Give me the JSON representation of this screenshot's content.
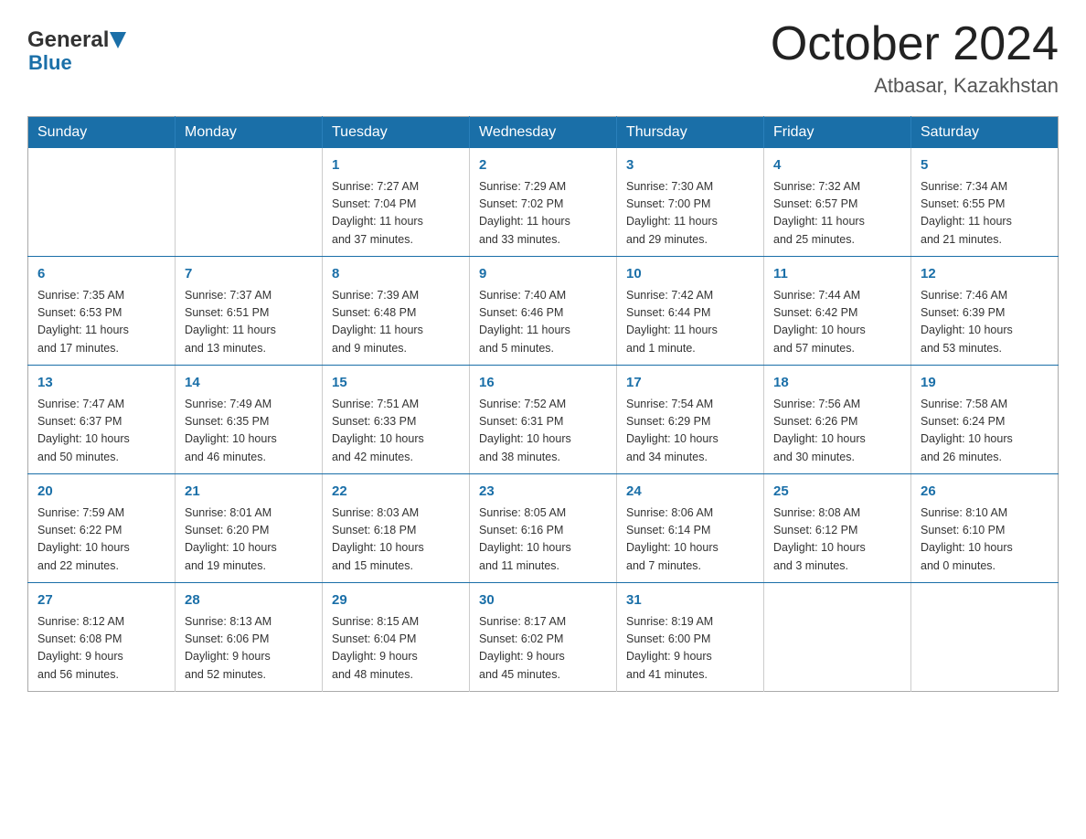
{
  "header": {
    "logo_general": "General",
    "logo_blue": "Blue",
    "month_title": "October 2024",
    "location": "Atbasar, Kazakhstan"
  },
  "days_of_week": [
    "Sunday",
    "Monday",
    "Tuesday",
    "Wednesday",
    "Thursday",
    "Friday",
    "Saturday"
  ],
  "weeks": [
    [
      {
        "day": "",
        "info": ""
      },
      {
        "day": "",
        "info": ""
      },
      {
        "day": "1",
        "info": "Sunrise: 7:27 AM\nSunset: 7:04 PM\nDaylight: 11 hours\nand 37 minutes."
      },
      {
        "day": "2",
        "info": "Sunrise: 7:29 AM\nSunset: 7:02 PM\nDaylight: 11 hours\nand 33 minutes."
      },
      {
        "day": "3",
        "info": "Sunrise: 7:30 AM\nSunset: 7:00 PM\nDaylight: 11 hours\nand 29 minutes."
      },
      {
        "day": "4",
        "info": "Sunrise: 7:32 AM\nSunset: 6:57 PM\nDaylight: 11 hours\nand 25 minutes."
      },
      {
        "day": "5",
        "info": "Sunrise: 7:34 AM\nSunset: 6:55 PM\nDaylight: 11 hours\nand 21 minutes."
      }
    ],
    [
      {
        "day": "6",
        "info": "Sunrise: 7:35 AM\nSunset: 6:53 PM\nDaylight: 11 hours\nand 17 minutes."
      },
      {
        "day": "7",
        "info": "Sunrise: 7:37 AM\nSunset: 6:51 PM\nDaylight: 11 hours\nand 13 minutes."
      },
      {
        "day": "8",
        "info": "Sunrise: 7:39 AM\nSunset: 6:48 PM\nDaylight: 11 hours\nand 9 minutes."
      },
      {
        "day": "9",
        "info": "Sunrise: 7:40 AM\nSunset: 6:46 PM\nDaylight: 11 hours\nand 5 minutes."
      },
      {
        "day": "10",
        "info": "Sunrise: 7:42 AM\nSunset: 6:44 PM\nDaylight: 11 hours\nand 1 minute."
      },
      {
        "day": "11",
        "info": "Sunrise: 7:44 AM\nSunset: 6:42 PM\nDaylight: 10 hours\nand 57 minutes."
      },
      {
        "day": "12",
        "info": "Sunrise: 7:46 AM\nSunset: 6:39 PM\nDaylight: 10 hours\nand 53 minutes."
      }
    ],
    [
      {
        "day": "13",
        "info": "Sunrise: 7:47 AM\nSunset: 6:37 PM\nDaylight: 10 hours\nand 50 minutes."
      },
      {
        "day": "14",
        "info": "Sunrise: 7:49 AM\nSunset: 6:35 PM\nDaylight: 10 hours\nand 46 minutes."
      },
      {
        "day": "15",
        "info": "Sunrise: 7:51 AM\nSunset: 6:33 PM\nDaylight: 10 hours\nand 42 minutes."
      },
      {
        "day": "16",
        "info": "Sunrise: 7:52 AM\nSunset: 6:31 PM\nDaylight: 10 hours\nand 38 minutes."
      },
      {
        "day": "17",
        "info": "Sunrise: 7:54 AM\nSunset: 6:29 PM\nDaylight: 10 hours\nand 34 minutes."
      },
      {
        "day": "18",
        "info": "Sunrise: 7:56 AM\nSunset: 6:26 PM\nDaylight: 10 hours\nand 30 minutes."
      },
      {
        "day": "19",
        "info": "Sunrise: 7:58 AM\nSunset: 6:24 PM\nDaylight: 10 hours\nand 26 minutes."
      }
    ],
    [
      {
        "day": "20",
        "info": "Sunrise: 7:59 AM\nSunset: 6:22 PM\nDaylight: 10 hours\nand 22 minutes."
      },
      {
        "day": "21",
        "info": "Sunrise: 8:01 AM\nSunset: 6:20 PM\nDaylight: 10 hours\nand 19 minutes."
      },
      {
        "day": "22",
        "info": "Sunrise: 8:03 AM\nSunset: 6:18 PM\nDaylight: 10 hours\nand 15 minutes."
      },
      {
        "day": "23",
        "info": "Sunrise: 8:05 AM\nSunset: 6:16 PM\nDaylight: 10 hours\nand 11 minutes."
      },
      {
        "day": "24",
        "info": "Sunrise: 8:06 AM\nSunset: 6:14 PM\nDaylight: 10 hours\nand 7 minutes."
      },
      {
        "day": "25",
        "info": "Sunrise: 8:08 AM\nSunset: 6:12 PM\nDaylight: 10 hours\nand 3 minutes."
      },
      {
        "day": "26",
        "info": "Sunrise: 8:10 AM\nSunset: 6:10 PM\nDaylight: 10 hours\nand 0 minutes."
      }
    ],
    [
      {
        "day": "27",
        "info": "Sunrise: 8:12 AM\nSunset: 6:08 PM\nDaylight: 9 hours\nand 56 minutes."
      },
      {
        "day": "28",
        "info": "Sunrise: 8:13 AM\nSunset: 6:06 PM\nDaylight: 9 hours\nand 52 minutes."
      },
      {
        "day": "29",
        "info": "Sunrise: 8:15 AM\nSunset: 6:04 PM\nDaylight: 9 hours\nand 48 minutes."
      },
      {
        "day": "30",
        "info": "Sunrise: 8:17 AM\nSunset: 6:02 PM\nDaylight: 9 hours\nand 45 minutes."
      },
      {
        "day": "31",
        "info": "Sunrise: 8:19 AM\nSunset: 6:00 PM\nDaylight: 9 hours\nand 41 minutes."
      },
      {
        "day": "",
        "info": ""
      },
      {
        "day": "",
        "info": ""
      }
    ]
  ]
}
